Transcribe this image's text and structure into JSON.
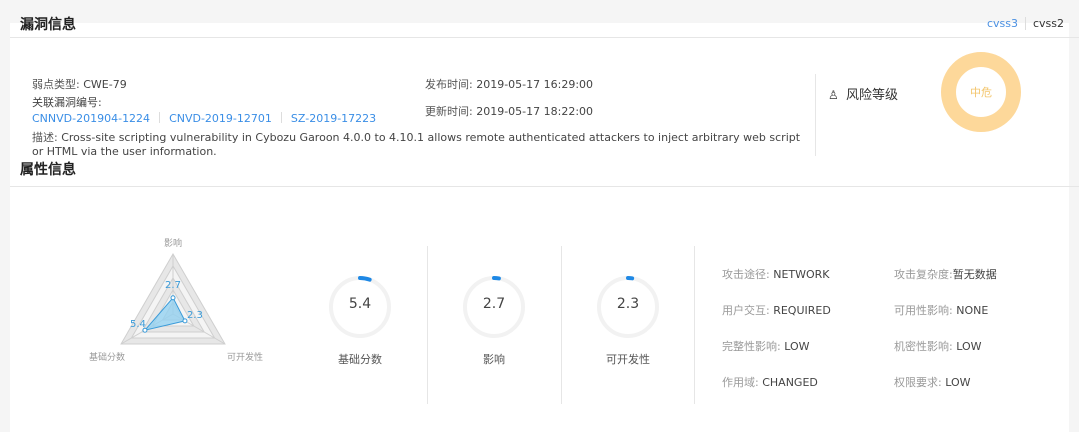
{
  "vuln_info": {
    "title": "漏洞信息",
    "tabs": [
      "cvss3",
      "cvss2"
    ],
    "weakness_label": "弱点类型:",
    "weakness_value": "CWE-79",
    "related_label": "关联漏洞编号:",
    "related_ids": [
      "CNNVD-201904-1224",
      "CNVD-2019-12701",
      "SZ-2019-17223"
    ],
    "desc_label": "描述:",
    "desc_value": "Cross-site scripting vulnerability in Cybozu Garoon 4.0.0 to 4.10.1 allows remote authenticated attackers to inject arbitrary web script or HTML via the user information.",
    "publish_label": "发布时间:",
    "publish_value": "2019-05-17 16:29:00",
    "update_label": "更新时间:",
    "update_value": "2019-05-17 18:22:00",
    "risk_label": "风险等级",
    "risk_value": "中危",
    "risk_color": "#fdd89a"
  },
  "attr_info": {
    "title": "属性信息",
    "radar": {
      "axes": [
        "影响",
        "基础分数",
        "可开发性"
      ],
      "values": [
        2.7,
        5.4,
        2.3
      ],
      "max": 10,
      "value_labels": [
        "2.7",
        "5.4",
        "2.3"
      ],
      "fill_color": "#8fd0f2",
      "stroke_color": "#3a9bd9"
    },
    "gauges": [
      {
        "value": "5.4",
        "label": "基础分数",
        "fraction": 0.054
      },
      {
        "value": "2.7",
        "label": "影响",
        "fraction": 0.027
      },
      {
        "value": "2.3",
        "label": "可开发性",
        "fraction": 0.023
      }
    ],
    "gauge_color": "#1e88e5",
    "attributes": [
      {
        "label": "攻击途径:",
        "value": "NETWORK"
      },
      {
        "label": "攻击复杂度:",
        "value": "暂无数据"
      },
      {
        "label": "用户交互:",
        "value": "REQUIRED"
      },
      {
        "label": "可用性影响:",
        "value": "NONE"
      },
      {
        "label": "完整性影响:",
        "value": "LOW"
      },
      {
        "label": "机密性影响:",
        "value": "LOW"
      },
      {
        "label": "作用域:",
        "value": "CHANGED"
      },
      {
        "label": "权限要求:",
        "value": "LOW"
      }
    ]
  }
}
